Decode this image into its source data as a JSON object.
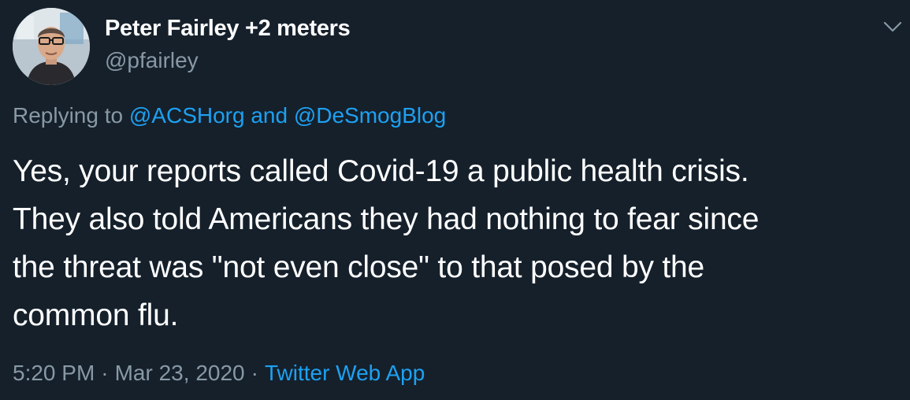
{
  "author": {
    "display_name": "Peter Fairley +2 meters",
    "handle": "@pfairley",
    "avatar_icon": "profile-photo"
  },
  "menu": {
    "icon": "chevron-down-icon"
  },
  "reply": {
    "prefix": "Replying to",
    "mention_1": "@ACSHorg",
    "conjunction": "and",
    "mention_2": "@DeSmogBlog"
  },
  "tweet": {
    "text": "Yes, your reports called Covid-19 a public health crisis.\nThey also told Americans they had nothing to fear since\nthe threat was \"not even close\" to that posed by the\ncommon flu."
  },
  "meta": {
    "time": "5:20 PM",
    "separator": "·",
    "date": "Mar 23, 2020",
    "source": "Twitter Web App"
  },
  "colors": {
    "background": "#15202b",
    "primary_text": "#ffffff",
    "secondary_text": "#8899a6",
    "link": "#1da1f2"
  }
}
